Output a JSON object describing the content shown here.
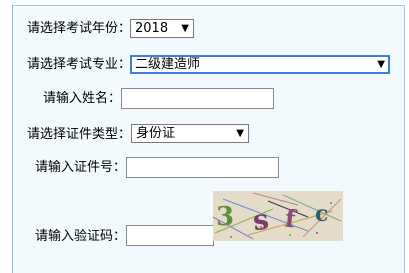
{
  "form": {
    "year_label": "请选择考试年份：",
    "year_value": "2018",
    "major_label": "请选择考试专业：",
    "major_value": "二级建造师",
    "name_label": "请输入姓名：",
    "name_value": "",
    "idtype_label": "请选择证件类型：",
    "idtype_value": "身份证",
    "idnum_label": "请输入证件号：",
    "idnum_value": "",
    "captcha_label": "请输入验证码：",
    "captcha_value": "",
    "captcha_text": "3sfc"
  },
  "icons": {
    "dropdown": "triangle-down-icon"
  },
  "colors": {
    "panel_background": "#f3fafd",
    "panel_border": "#9ecbe2",
    "focus_border": "#3c7fd6"
  }
}
